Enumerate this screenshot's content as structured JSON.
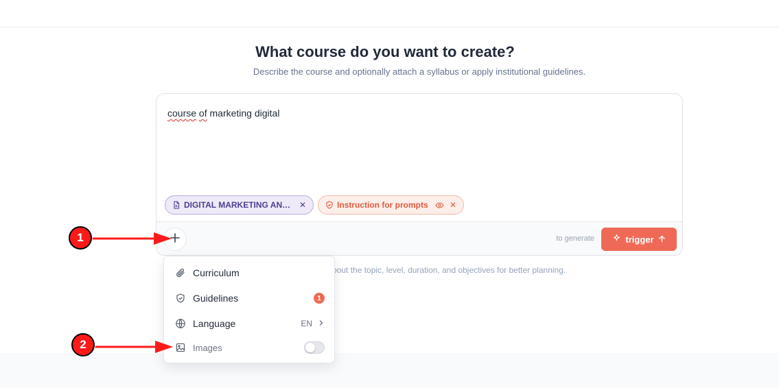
{
  "page": {
    "title": "What course do you want to create?",
    "subtitle": "Describe the course and optionally attach a syllabus or apply institutional guidelines."
  },
  "composer": {
    "prompt_words": [
      "course",
      "of",
      "marketing digital"
    ],
    "chips": [
      {
        "label": "DIGITAL MARKETING AN…",
        "icon": "document-icon",
        "close": "✕"
      },
      {
        "label": "Instruction for prompts",
        "icon": "shield-icon",
        "close": "✕"
      }
    ],
    "hint": "to generate",
    "trigger_label": "trigger"
  },
  "tip": "bout the topic, level, duration, and objectives for better planning.",
  "menu": {
    "items": [
      {
        "label": "Curriculum",
        "icon": "paperclip-icon"
      },
      {
        "label": "Guidelines",
        "icon": "shield-check-icon",
        "badge": "1"
      },
      {
        "label": "Language",
        "icon": "globe-icon",
        "value": "EN"
      },
      {
        "label": "Images",
        "icon": "image-icon",
        "toggle": false
      }
    ]
  },
  "annotations": [
    {
      "number": "1"
    },
    {
      "number": "2"
    }
  ],
  "colors": {
    "accent": "#ee6a56",
    "syllabus_chip": "#4c3d8f",
    "annotation": "#ff1a1a"
  }
}
